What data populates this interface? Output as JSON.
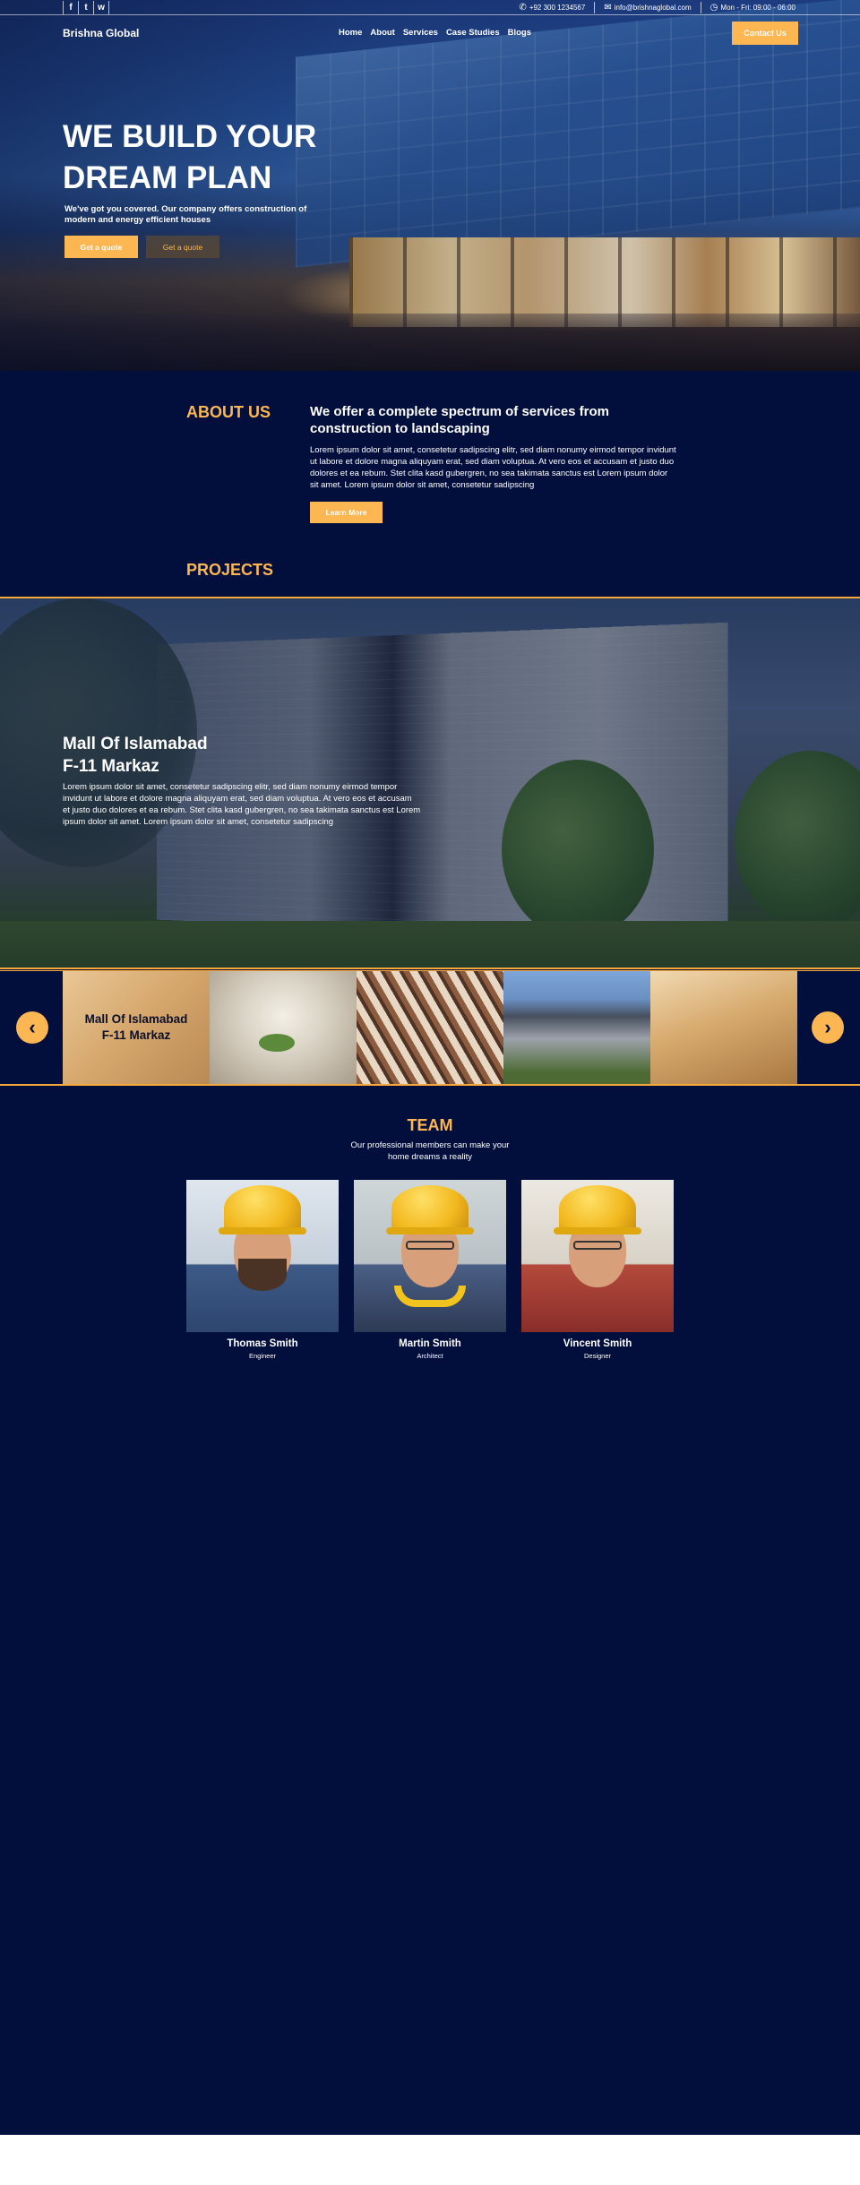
{
  "header": {
    "social": [
      {
        "icon": "facebook-icon",
        "glyph": "f"
      },
      {
        "icon": "twitter-icon",
        "glyph": "t"
      },
      {
        "icon": "whatsapp-icon",
        "glyph": "w"
      }
    ],
    "phone": "+92 300 1234567",
    "email": "info@brishnaglobal.com",
    "hours": "Mon - Fri: 09:00 - 06:00",
    "brand": "Brishna Global",
    "nav": [
      "Home",
      "About",
      "Services",
      "Case Studies",
      "Blogs"
    ],
    "contact_button": "Contact Us"
  },
  "hero": {
    "title": "WE BUILD YOUR DREAM PLAN",
    "subtitle": "We've got you covered. Our company offers construction of modern and energy efficient houses",
    "primary_button": "Get a quote",
    "secondary_button": "Get a quote"
  },
  "about": {
    "heading": "ABOUT US",
    "title": "We offer a complete spectrum of services from construction to landscaping",
    "text": "Lorem ipsum dolor sit amet, consetetur sadipscing elitr, sed diam nonumy eirmod tempor invidunt ut labore et dolore magna aliquyam erat, sed diam voluptua. At vero eos et accusam et justo duo dolores et ea rebum. Stet clita kasd gubergren, no sea takimata sanctus est Lorem ipsum dolor sit amet. Lorem ipsum dolor sit amet, consetetur sadipscing",
    "button": "Learn More"
  },
  "projects": {
    "heading": "PROJECTS",
    "featured_title_line1": "Mall Of Islamabad",
    "featured_title_line2": "F-11 Markaz",
    "featured_text": "Lorem ipsum dolor sit amet, consetetur sadipscing elitr, sed diam nonumy eirmod tempor invidunt ut labore et dolore magna aliquyam erat, sed diam voluptua. At vero eos et accusam et justo duo dolores et ea rebum. Stet clita kasd gubergren, no sea takimata sanctus est Lorem ipsum dolor sit amet. Lorem ipsum dolor sit amet, consetetur sadipscing",
    "slide_caption_line1": "Mall Of Islamabad",
    "slide_caption_line2": "F-11 Markaz",
    "prev_icon": "chevron-left-icon",
    "next_icon": "chevron-right-icon"
  },
  "team": {
    "heading": "TEAM",
    "subtitle": "Our professional members can make your home dreams a reality",
    "members": [
      {
        "name": "Thomas Smith",
        "role": "Engineer"
      },
      {
        "name": "Martin Smith",
        "role": "Architect"
      },
      {
        "name": "Vincent Smith",
        "role": "Designer"
      }
    ]
  },
  "colors": {
    "accent": "#fcb652",
    "background": "#020f3c",
    "border": "#f7a83b"
  }
}
